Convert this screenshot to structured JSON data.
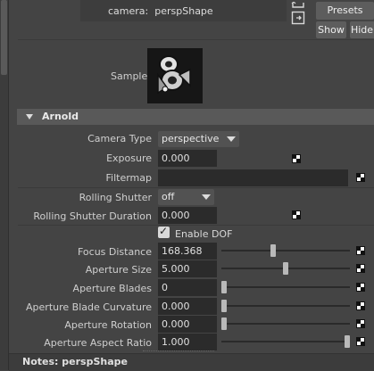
{
  "top": {
    "camera_label": "camera:",
    "camera_value": "perspShape",
    "presets_label": "Presets",
    "show_label": "Show",
    "hide_label": "Hide"
  },
  "sample": {
    "label": "Sample"
  },
  "section": {
    "title": "Arnold"
  },
  "rows": {
    "camera_type": {
      "label": "Camera Type",
      "value": "perspective"
    },
    "exposure": {
      "label": "Exposure",
      "value": "0.000"
    },
    "filtermap": {
      "label": "Filtermap",
      "value": ""
    },
    "rolling_shutter": {
      "label": "Rolling Shutter",
      "value": "off"
    },
    "rolling_shutter_duration": {
      "label": "Rolling Shutter Duration",
      "value": "0.000"
    },
    "enable_dof": {
      "label": "Enable DOF",
      "checked": true
    },
    "focus_distance": {
      "label": "Focus Distance",
      "value": "168.368",
      "slider_fraction": 0.4
    },
    "aperture_size": {
      "label": "Aperture Size",
      "value": "5.000",
      "slider_fraction": 0.5
    },
    "aperture_blades": {
      "label": "Aperture Blades",
      "value": "0",
      "slider_fraction": 0.0
    },
    "aperture_blade_curvature": {
      "label": "Aperture Blade Curvature",
      "value": "0.000",
      "slider_fraction": 0.0
    },
    "aperture_rotation": {
      "label": "Aperture Rotation",
      "value": "0.000",
      "slider_fraction": 0.0
    },
    "aperture_aspect_ratio": {
      "label": "Aperture Aspect Ratio",
      "value": "1.000",
      "slider_fraction": 1.0
    }
  },
  "notes": {
    "label": "Notes:  perspShape"
  },
  "colors": {
    "panel_bg": "#444444",
    "field_bg": "#2b2b2b",
    "header_bg": "#595959",
    "button_bg": "#5d5d5d"
  }
}
